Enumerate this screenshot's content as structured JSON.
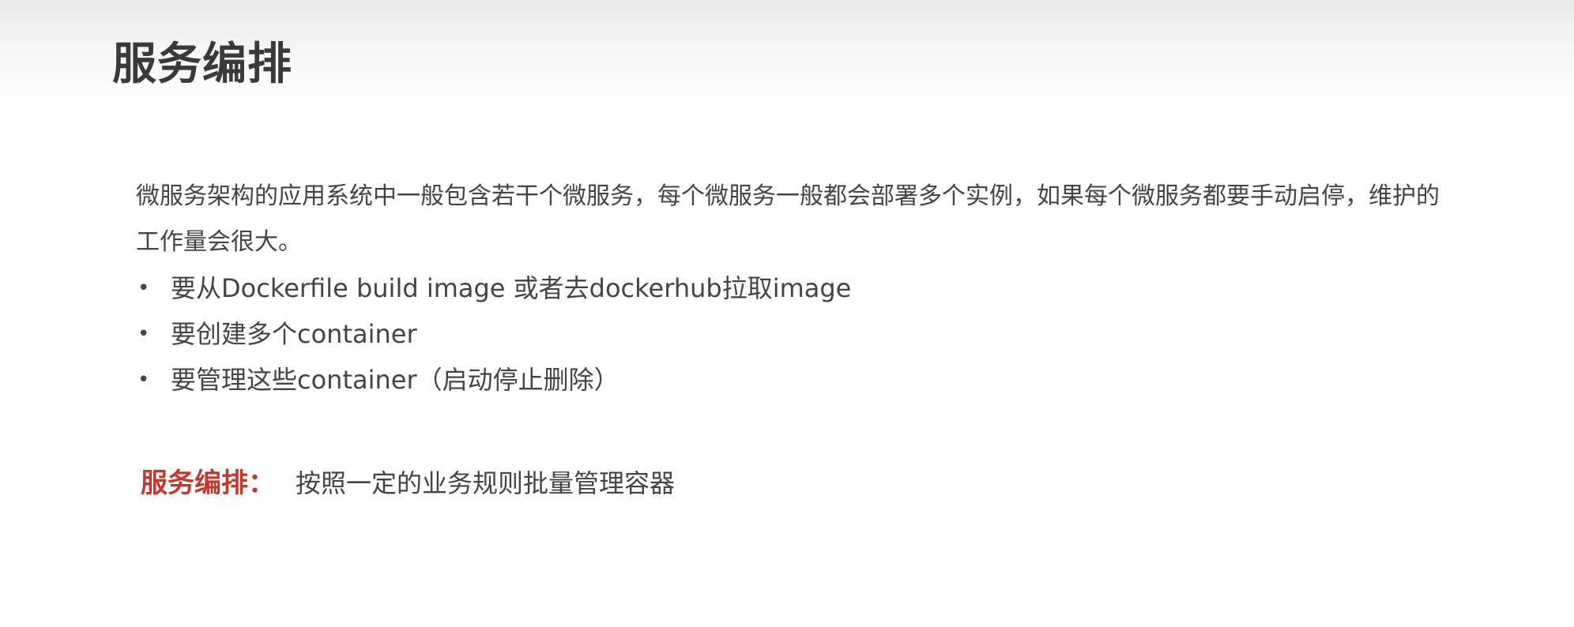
{
  "slide": {
    "title": "服务编排",
    "intro": "微服务架构的应用系统中一般包含若干个微服务，每个微服务一般都会部署多个实例，如果每个微服务都要手动启停，维护的工作量会很大。",
    "bullet_symbol": "•",
    "bullets": [
      "要从Dockerfile build image 或者去dockerhub拉取image",
      "要创建多个container",
      "要管理这些container（启动停止删除）"
    ],
    "definition": {
      "term": "服务编排：",
      "text": "按照一定的业务规则批量管理容器"
    },
    "colors": {
      "accent": "#c0392b",
      "text": "#444444",
      "title": "#3a3a3a"
    }
  }
}
